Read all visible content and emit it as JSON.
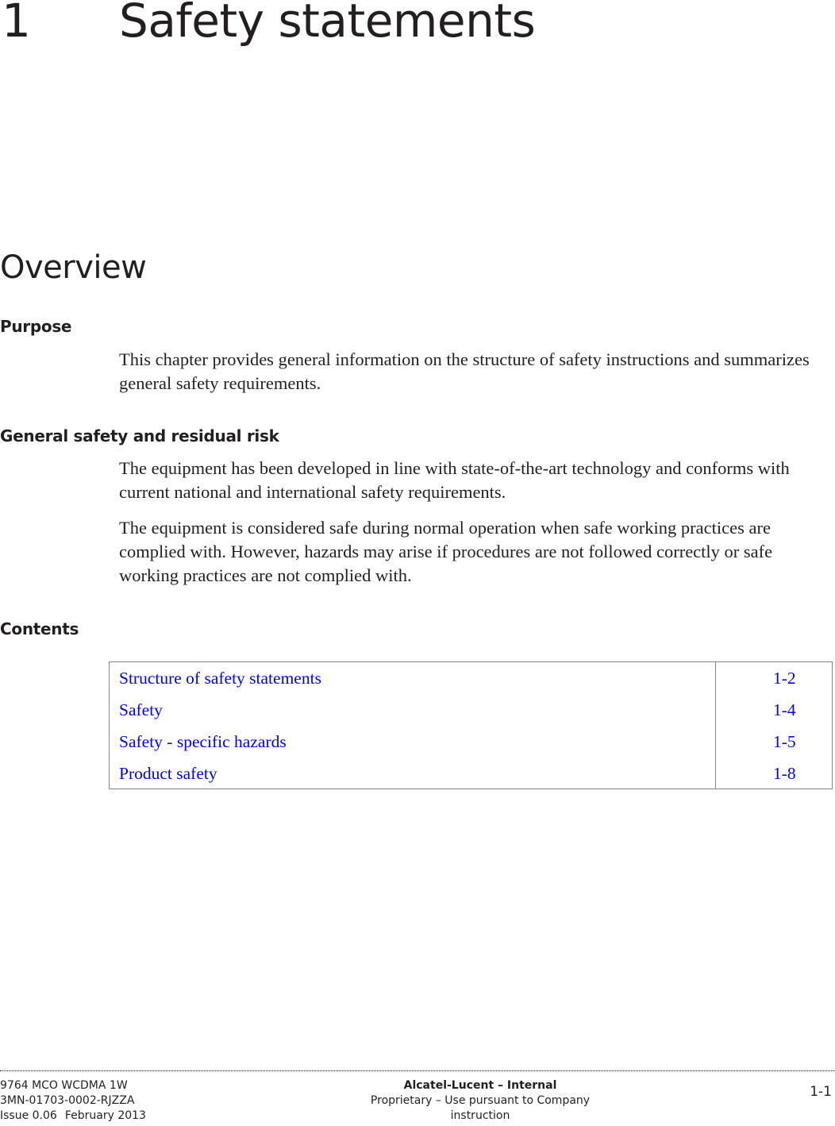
{
  "chapter": {
    "number": "1",
    "title": "Safety statements"
  },
  "overview": {
    "title": "Overview"
  },
  "sections": {
    "purpose": {
      "heading": "Purpose",
      "paragraphs": [
        "This chapter provides general information on the structure of safety instructions and summarizes general safety requirements."
      ]
    },
    "general_safety": {
      "heading": "General safety and residual risk",
      "paragraphs": [
        "The equipment has been developed in line with state-of-the-art technology and conforms with current national and international safety requirements.",
        "The equipment is considered safe during normal operation when safe working practices are complied with. However, hazards may arise if procedures are not followed correctly or safe working practices are not complied with."
      ]
    },
    "contents": {
      "heading": "Contents",
      "items": [
        {
          "title": "Structure of safety statements",
          "page": "1-2"
        },
        {
          "title": "Safety",
          "page": "1-4"
        },
        {
          "title": "Safety - specific hazards",
          "page": "1-5"
        },
        {
          "title": "Product safety",
          "page": "1-8"
        }
      ]
    }
  },
  "footer": {
    "product": "9764 MCO WCDMA 1W",
    "doc_number": "3MN-01703-0002-RJZZA",
    "issue": "Issue 0.06",
    "date": "February 2013",
    "classification": "Alcatel-Lucent – Internal",
    "proprietary": "Proprietary – Use pursuant to Company instruction",
    "page_number": "1-1"
  },
  "colors": {
    "text": "#231f20",
    "link": "#0000ff",
    "table_border": "#8a8480"
  }
}
